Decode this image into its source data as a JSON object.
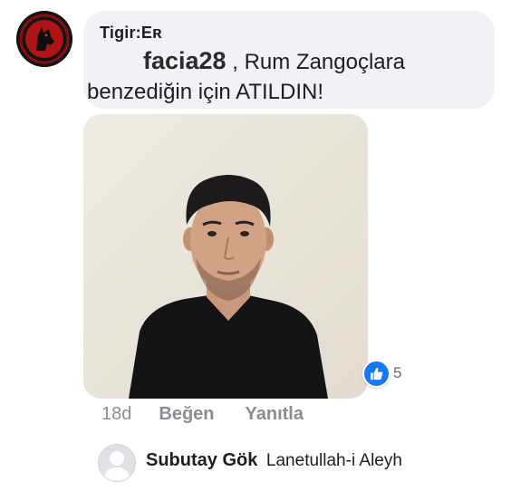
{
  "comment": {
    "author": "Tigir:Eʀ",
    "mention": "facia28",
    "text_line1": " , Rum Zangoçlara",
    "text_line2": "benzediğin için ATILDIN!",
    "avatar_icon": "wolf-emblem-icon",
    "photo_icon": "portrait-photo"
  },
  "reactions": {
    "icon": "like-icon",
    "count": "5",
    "color": "#1877f2"
  },
  "actions": {
    "timestamp": "18d",
    "like_label": "Beğen",
    "reply_label": "Yanıtla"
  },
  "reply": {
    "avatar_icon": "default-avatar-icon",
    "author": "Subutay Gök",
    "text": "Lanetullah-i Aleyh"
  }
}
